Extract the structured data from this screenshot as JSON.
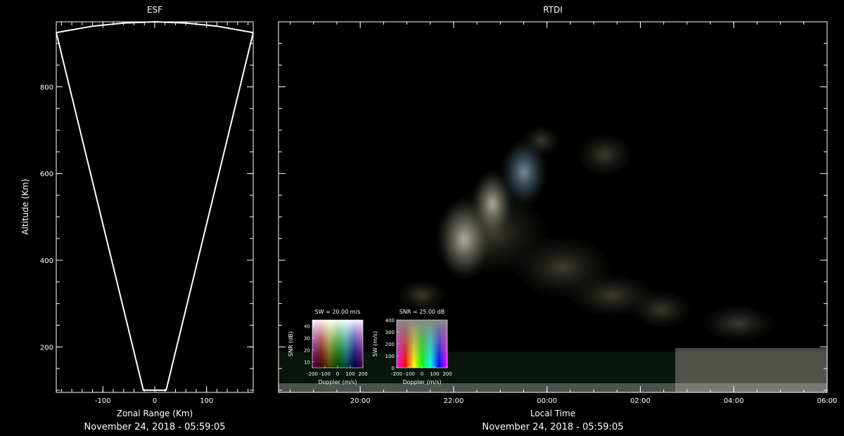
{
  "colors": {
    "background": "#000000",
    "foreground": "#ffffff"
  },
  "chart_data": [
    {
      "type": "line",
      "title": "ESF",
      "xlabel": "Zonal Range (Km)",
      "ylabel": "Altitude (Km)",
      "footer": "November 24, 2018 - 05:59:05",
      "xlim": [
        -190,
        190
      ],
      "ylim": [
        95,
        950
      ],
      "xticks": [
        -100,
        0,
        100
      ],
      "yticks": [
        200,
        400,
        600,
        800
      ],
      "series": [
        {
          "points": [
            [
              -190,
              925
            ],
            [
              -22,
              100
            ],
            [
              22,
              100
            ],
            [
              190,
              925
            ]
          ]
        },
        {
          "points": [
            [
              -190,
              925
            ],
            [
              -120,
              940
            ],
            [
              -60,
              947
            ],
            [
              0,
              950
            ],
            [
              60,
              947
            ],
            [
              120,
              940
            ],
            [
              190,
              925
            ]
          ]
        }
      ]
    },
    {
      "type": "heatmap",
      "title": "RTDI",
      "xlabel": "Local Time",
      "footer": "November 24, 2018 - 05:59:05",
      "xlim": [
        "18:15",
        "06:00"
      ],
      "ylim": [
        95,
        950
      ],
      "xticks": [
        "20:00",
        "22:00",
        "00:00",
        "02:00",
        "04:00",
        "06:00"
      ],
      "encoding": "RGB composite of Doppler, spectral width and SNR"
    },
    {
      "type": "heatmap",
      "title": "SW = 20.00 m/s",
      "xlabel": "Doppler (m/s)",
      "ylabel": "SNR (dB)",
      "xlim": [
        -200,
        200
      ],
      "ylim": [
        5,
        45
      ],
      "xticks": [
        "-200",
        "-100",
        "0",
        "100",
        "200"
      ],
      "yticks": [
        10,
        20,
        30,
        40
      ]
    },
    {
      "type": "heatmap",
      "title": "SNR = 25.00 dB",
      "xlabel": "Doppler (m/s)",
      "ylabel": "SW (m/s)",
      "xlim": [
        -200,
        200
      ],
      "ylim": [
        0,
        400
      ],
      "xticks": [
        "-200",
        "-100",
        "0",
        "100",
        "200"
      ],
      "yticks": [
        0,
        100,
        200,
        300,
        400
      ]
    }
  ]
}
